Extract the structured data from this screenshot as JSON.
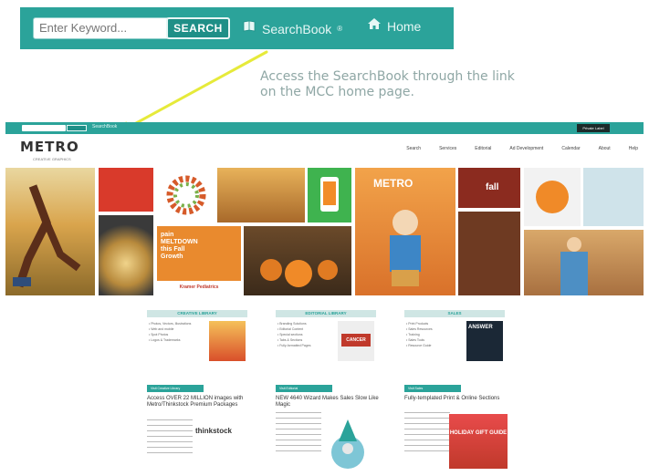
{
  "top_bar": {
    "keyword_placeholder": "Enter Keyword...",
    "search_label": "SEARCH",
    "searchbook_label": "SearchBook",
    "registered_mark": "®",
    "home_label": "Home"
  },
  "callout": {
    "line1": "Access the SearchBook through the link",
    "line2": "on the MCC home page."
  },
  "site": {
    "logo": "METRO",
    "logo_tagline": "CREATIVE GRAPHICS",
    "top_dark_button": "Private Label",
    "nav": [
      "Search",
      "Services",
      "Editorial",
      "Ad Development",
      "Calendar",
      "About",
      "Help"
    ],
    "collage_texts": {
      "pediatrics_title": "pain MELTDOWN this Fall Growth",
      "pediatrics_sub": "Kramer Pediatrics",
      "fall": "fall",
      "metro": "METRO"
    },
    "columns": [
      {
        "head": "CREATIVE LIBRARY",
        "items": [
          "Photos, Vectors, Illustrations",
          "Web and mobile",
          "Spot Photos",
          "Logos & Trademarks"
        ]
      },
      {
        "head": "EDITORIAL LIBRARY",
        "items": [
          "Branding Solutions",
          "Editorial Content",
          "Special sections",
          "Tabs & Sections",
          "Fully-formatted Pages"
        ]
      },
      {
        "head": "SALES",
        "items": [
          "Print Products",
          "Sales Resources",
          "Training",
          "Sales Tools",
          "Resource Guide"
        ]
      }
    ],
    "column_thumb_texts": [
      "",
      "CANCER",
      "ANSWER"
    ],
    "promos": [
      {
        "button": "Visit Creative Library",
        "title": "Access OVER 22 MILLION images with Metro/Thinkstock Premium Packages",
        "brand": "thinkstock"
      },
      {
        "button": "Visit Editorial",
        "title": "NEW 4640 Wizard Makes Sales Slow Like Magic",
        "brand": ""
      },
      {
        "button": "Visit Sales",
        "title": "Fully-templated Print & Online Sections",
        "brand": "HOLIDAY GIFT GUIDE"
      }
    ]
  },
  "colors": {
    "teal": "#2ba39a",
    "teal_dark": "#1f8f87",
    "callout_text": "#8fa7a5",
    "arrow": "#e6ea3a"
  },
  "icons": {
    "searchbook": "book-icon",
    "home": "home-icon"
  }
}
